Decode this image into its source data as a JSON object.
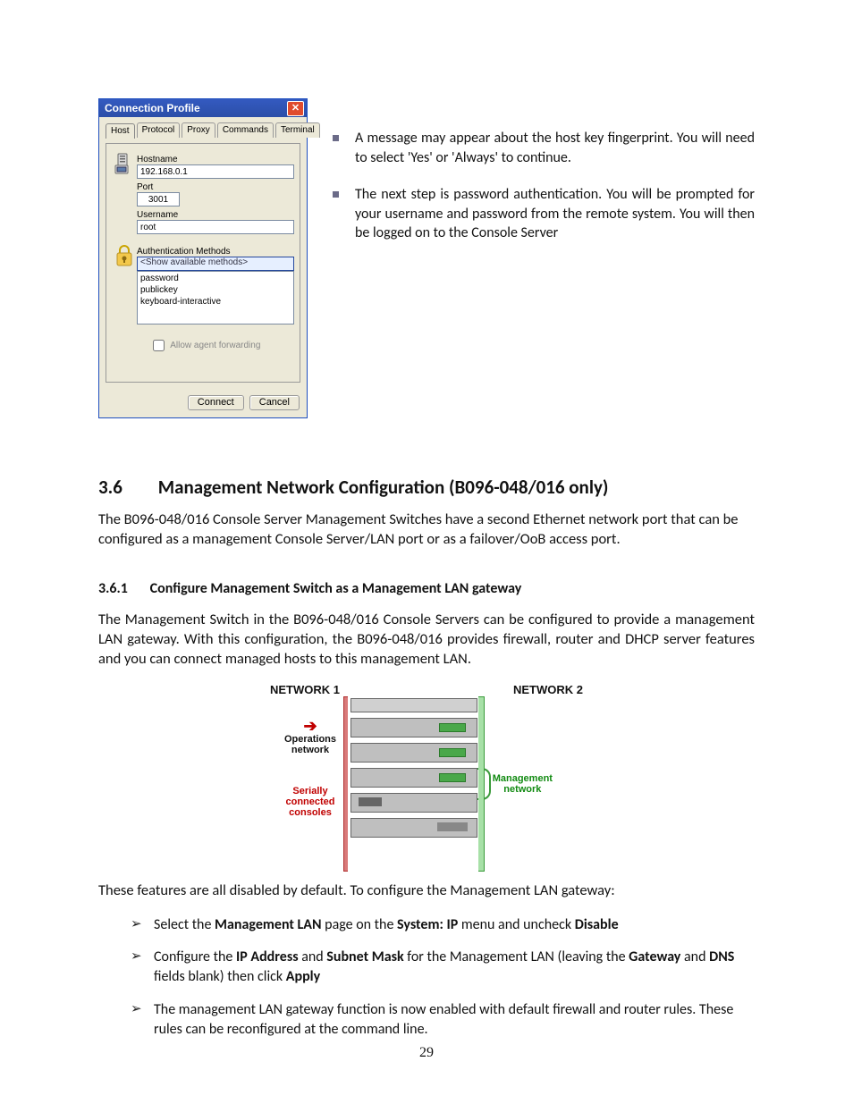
{
  "dialog": {
    "title": "Connection Profile",
    "tabs": [
      "Host",
      "Protocol",
      "Proxy",
      "Commands",
      "Terminal"
    ],
    "active_tab": "Host",
    "hostname_label": "Hostname",
    "hostname_value": "192.168.0.1",
    "port_label": "Port",
    "port_value": "3001",
    "username_label": "Username",
    "username_value": "root",
    "auth_label": "Authentication Methods",
    "auth_placeholder": "<Show available methods>",
    "auth_methods": [
      "password",
      "publickey",
      "keyboard-interactive"
    ],
    "allow_forwarding": "Allow agent forwarding",
    "btn_connect": "Connect",
    "btn_cancel": "Cancel"
  },
  "notes": {
    "a": "A message may appear about the host key fingerprint. You will need to select 'Yes' or 'Always' to continue.",
    "b": "The next step is password authentication. You will be prompted for your username and password from the remote system. You will then be logged on to the Console Server"
  },
  "section": {
    "num": "3.6",
    "title": "Management Network Configuration (B096-048/016 only)"
  },
  "para1": "The B096-048/016 Console Server Management Switches have a second Ethernet network port that can be configured as a management Console Server/LAN port or as a failover/OoB access port.",
  "subsection": {
    "num": "3.6.1",
    "title": "Configure Management Switch as a Management LAN gateway"
  },
  "para2": "The Management Switch in the B096-048/016 Console Servers can be configured to provide a management LAN gateway. With this configuration, the B096-048/016 provides firewall, router and DHCP server features and you can connect managed hosts to this management LAN.",
  "diagram": {
    "net1": "NETWORK 1",
    "net2": "NETWORK 2",
    "ops": "Operations network",
    "serial": "Serially connected consoles",
    "mgmt": "Management network"
  },
  "para3": "These features are all disabled by default. To configure the Management LAN gateway:",
  "steps": {
    "s1a": "Select the ",
    "s1b": "Management LAN",
    "s1c": " page on the ",
    "s1d": "System: IP",
    "s1e": " menu and uncheck ",
    "s1f": "Disable",
    "s2a": "Configure the ",
    "s2b": "IP Address",
    "s2c": " and ",
    "s2d": "Subnet Mask",
    "s2e": " for the Management LAN (leaving the ",
    "s2f": "Gateway",
    "s2g": " and ",
    "s2h": "DNS",
    "s2i": " fields blank) then click ",
    "s2j": "Apply",
    "s3": "The management LAN gateway function is now enabled with default firewall and router rules. These rules can be reconfigured at the command line."
  },
  "pagenum": "29"
}
